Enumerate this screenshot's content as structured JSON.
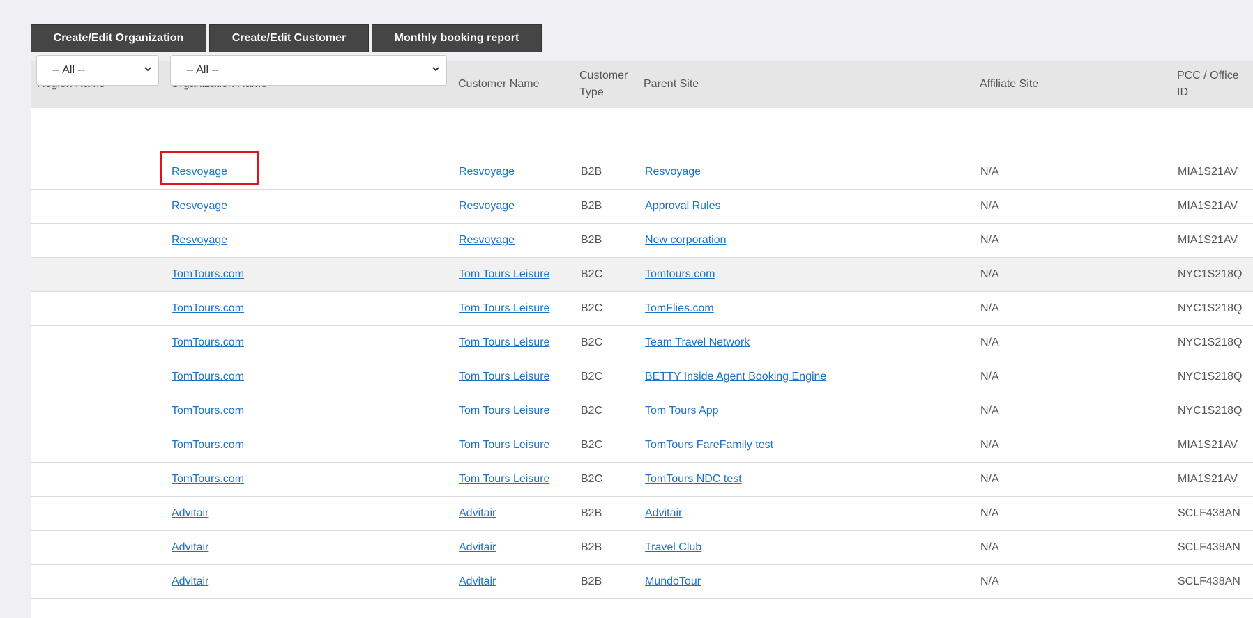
{
  "toolbar": {
    "buttons": [
      {
        "label": "Create/Edit Organization"
      },
      {
        "label": "Create/Edit Customer"
      },
      {
        "label": "Monthly booking report"
      }
    ]
  },
  "table": {
    "headers": {
      "region": "Region Name",
      "organization": "Organization Name",
      "customer": "Customer Name",
      "customer_type_1": "Customer",
      "customer_type_2": "Type",
      "parent": "Parent Site",
      "affiliate": "Affiliate Site",
      "pcc_1": "PCC / Office",
      "pcc_2": "ID"
    },
    "filters": {
      "region_selected": "-- All --",
      "organization_selected": "-- All --"
    },
    "rows": [
      {
        "organization": "Resvoyage",
        "customer": "Resvoyage",
        "type": "B2B",
        "parent": "Resvoyage",
        "affiliate": "N/A",
        "pcc": "MIA1S21AV"
      },
      {
        "organization": "Resvoyage",
        "customer": "Resvoyage",
        "type": "B2B",
        "parent": "Approval Rules",
        "affiliate": "N/A",
        "pcc": "MIA1S21AV"
      },
      {
        "organization": "Resvoyage",
        "customer": "Resvoyage",
        "type": "B2B",
        "parent": "New corporation",
        "affiliate": "N/A",
        "pcc": "MIA1S21AV"
      },
      {
        "organization": "TomTours.com",
        "customer": "Tom Tours Leisure",
        "type": "B2C",
        "parent": "Tomtours.com",
        "affiliate": "N/A",
        "pcc": "NYC1S218Q"
      },
      {
        "organization": "TomTours.com",
        "customer": "Tom Tours Leisure",
        "type": "B2C",
        "parent": "TomFlies.com",
        "affiliate": "N/A",
        "pcc": "NYC1S218Q"
      },
      {
        "organization": "TomTours.com",
        "customer": "Tom Tours Leisure",
        "type": "B2C",
        "parent": "Team Travel Network",
        "affiliate": "N/A",
        "pcc": "NYC1S218Q"
      },
      {
        "organization": "TomTours.com",
        "customer": "Tom Tours Leisure",
        "type": "B2C",
        "parent": "BETTY Inside Agent Booking Engine",
        "affiliate": "N/A",
        "pcc": "NYC1S218Q"
      },
      {
        "organization": "TomTours.com",
        "customer": "Tom Tours Leisure",
        "type": "B2C",
        "parent": "Tom Tours App",
        "affiliate": "N/A",
        "pcc": "NYC1S218Q"
      },
      {
        "organization": "TomTours.com",
        "customer": "Tom Tours Leisure",
        "type": "B2C",
        "parent": "TomTours FareFamily test",
        "affiliate": "N/A",
        "pcc": "MIA1S21AV"
      },
      {
        "organization": "TomTours.com",
        "customer": "Tom Tours Leisure",
        "type": "B2C",
        "parent": "TomTours NDC test",
        "affiliate": "N/A",
        "pcc": "MIA1S21AV"
      },
      {
        "organization": "Advitair",
        "customer": "Advitair",
        "type": "B2B",
        "parent": "Advitair",
        "affiliate": "N/A",
        "pcc": "SCLF438AN"
      },
      {
        "organization": "Advitair",
        "customer": "Advitair",
        "type": "B2B",
        "parent": "Travel Club",
        "affiliate": "N/A",
        "pcc": "SCLF438AN"
      },
      {
        "organization": "Advitair",
        "customer": "Advitair",
        "type": "B2B",
        "parent": "MundoTour",
        "affiliate": "N/A",
        "pcc": "SCLF438AN"
      }
    ]
  },
  "colors": {
    "link": "#1a73c8",
    "highlight_box": "#e0141e",
    "toolbar_button": "#454545",
    "header_bg": "#e6e6e6"
  }
}
